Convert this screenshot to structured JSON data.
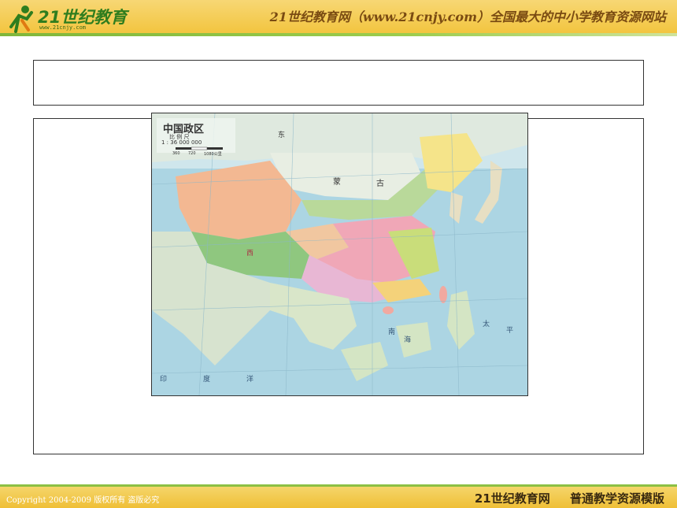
{
  "header": {
    "logo_text": "21世纪教育",
    "logo_url_text": "www.21cnjy.com",
    "slogan": "21世纪教育网（www.21cnjy.com）全国最大的中小学教育资源网站"
  },
  "map": {
    "title": "中国政区",
    "scale_label": "比 例 尺",
    "scale_value": "1 : 36 000 000",
    "scale_ticks": [
      "360",
      "720",
      "1080公里"
    ],
    "labels": [
      "蒙",
      "古",
      "东",
      "西",
      "南",
      "海",
      "印",
      "度",
      "洋",
      "太",
      "平"
    ]
  },
  "footer": {
    "copyright": "Copyright 2004-2009 版权所有 盗版必究",
    "site": "21世纪教育网",
    "template": "普通教学资源模版"
  },
  "colors": {
    "header_yellow": "#f2c33a",
    "accent_green": "#8cc043",
    "map_sea": "#a9d3e0"
  }
}
